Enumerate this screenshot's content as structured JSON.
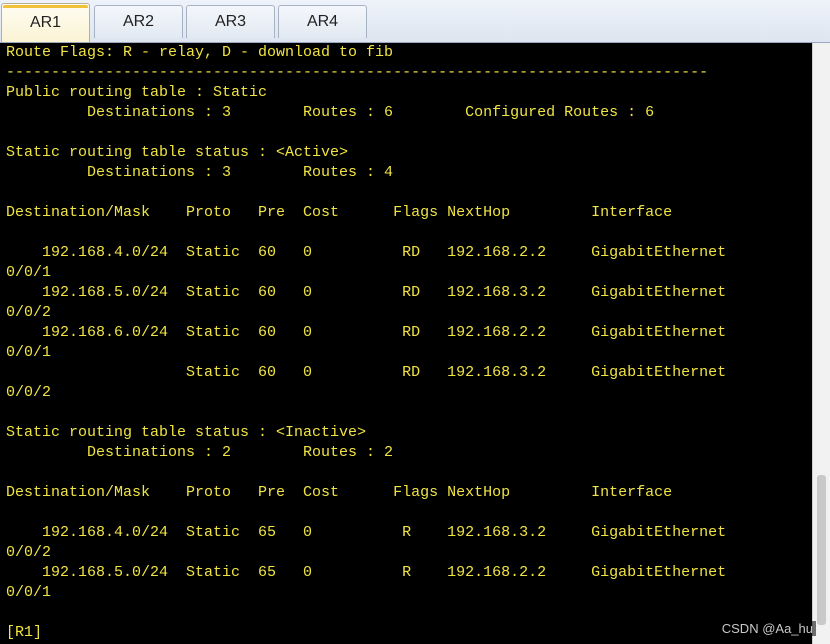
{
  "tabs": [
    {
      "label": "AR1",
      "active": true
    },
    {
      "label": "AR2",
      "active": false
    },
    {
      "label": "AR3",
      "active": false
    },
    {
      "label": "AR4",
      "active": false
    }
  ],
  "terminal": {
    "lines": [
      "Route Flags: R - relay, D - download to fib",
      "------------------------------------------------------------------------------",
      "Public routing table : Static",
      "         Destinations : 3        Routes : 6        Configured Routes : 6",
      "",
      "Static routing table status : <Active>",
      "         Destinations : 3        Routes : 4",
      "",
      "Destination/Mask    Proto   Pre  Cost      Flags NextHop         Interface",
      "",
      "    192.168.4.0/24  Static  60   0          RD   192.168.2.2     GigabitEthernet",
      "0/0/1",
      "    192.168.5.0/24  Static  60   0          RD   192.168.3.2     GigabitEthernet",
      "0/0/2",
      "    192.168.6.0/24  Static  60   0          RD   192.168.2.2     GigabitEthernet",
      "0/0/1",
      "                    Static  60   0          RD   192.168.3.2     GigabitEthernet",
      "0/0/2",
      "",
      "Static routing table status : <Inactive>",
      "         Destinations : 2        Routes : 2",
      "",
      "Destination/Mask    Proto   Pre  Cost      Flags NextHop         Interface",
      "",
      "    192.168.4.0/24  Static  65   0          R    192.168.3.2     GigabitEthernet",
      "0/0/2",
      "    192.168.5.0/24  Static  65   0          R    192.168.2.2     GigabitEthernet",
      "0/0/1",
      "",
      "[R1]"
    ]
  },
  "watermark": "CSDN @Aa_hu",
  "colors": {
    "terminal_bg": "#000000",
    "terminal_text": "#f0e442",
    "active_tab_accent": "#f0c23a"
  }
}
